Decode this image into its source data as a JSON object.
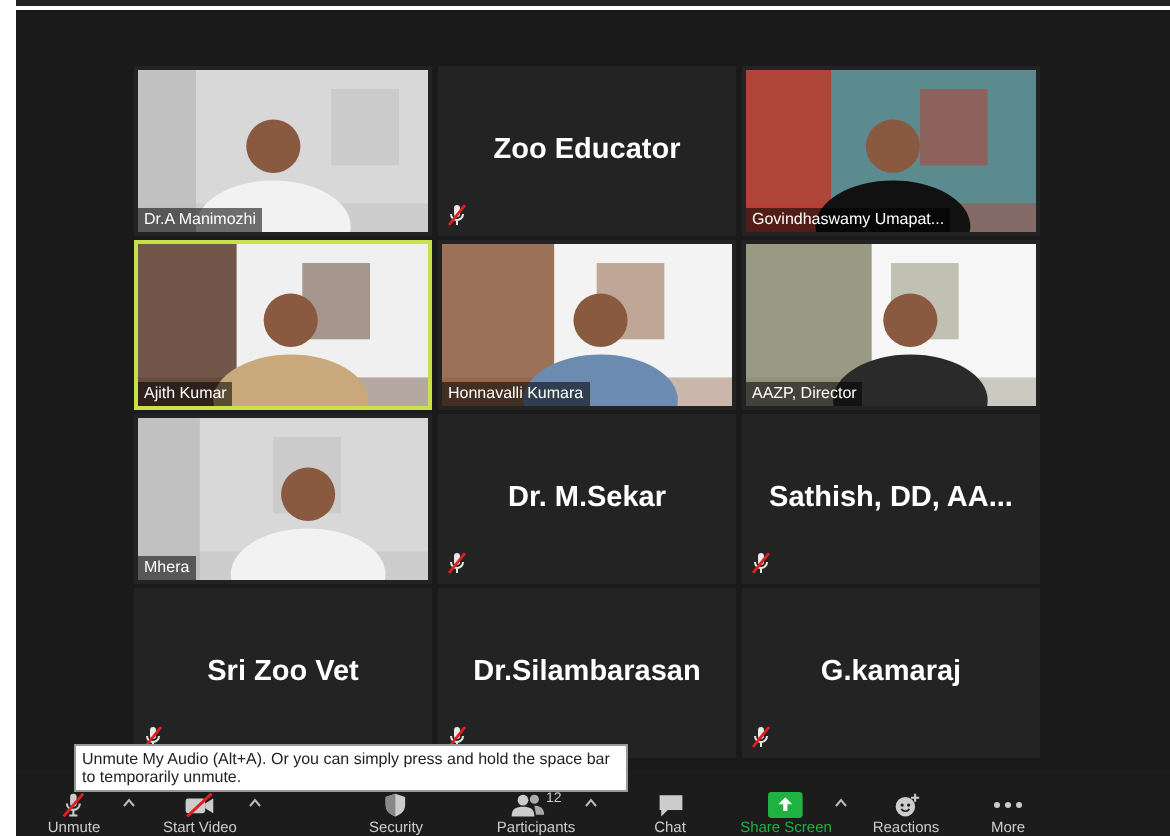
{
  "tiles": [
    {
      "kind": "video",
      "name": "Dr.A Manimozhi",
      "muted": false,
      "speaking": false
    },
    {
      "kind": "name",
      "name": "Zoo Educator",
      "muted": true,
      "speaking": false
    },
    {
      "kind": "video",
      "name": "Govindhaswamy Umapat...",
      "muted": false,
      "speaking": false
    },
    {
      "kind": "video",
      "name": "Ajith Kumar",
      "muted": false,
      "speaking": true
    },
    {
      "kind": "video",
      "name": "Honnavalli Kumara",
      "muted": false,
      "speaking": false
    },
    {
      "kind": "video",
      "name": "AAZP, Director",
      "muted": false,
      "speaking": false
    },
    {
      "kind": "video",
      "name": "Mhera",
      "muted": false,
      "speaking": false
    },
    {
      "kind": "name",
      "name": "Dr. M.Sekar",
      "muted": true,
      "speaking": false
    },
    {
      "kind": "name",
      "name": "Sathish, DD, AA...",
      "muted": true,
      "speaking": false
    },
    {
      "kind": "name",
      "name": "Sri Zoo Vet",
      "muted": true,
      "speaking": false
    },
    {
      "kind": "name",
      "name": "Dr.Silambarasan",
      "muted": true,
      "speaking": false
    },
    {
      "kind": "name",
      "name": "G.kamaraj",
      "muted": true,
      "speaking": false
    }
  ],
  "toolbar": [
    {
      "kind": "mic",
      "label": "Unmute",
      "off": true,
      "caret": true
    },
    {
      "kind": "video",
      "label": "Start Video",
      "off": true,
      "caret": true
    },
    {
      "kind": "security",
      "label": "Security",
      "caret": false
    },
    {
      "kind": "participants",
      "label": "Participants",
      "count": "12",
      "caret": true
    },
    {
      "kind": "chat",
      "label": "Chat",
      "caret": false
    },
    {
      "kind": "share",
      "label": "Share Screen",
      "caret": true
    },
    {
      "kind": "reactions",
      "label": "Reactions",
      "caret": false
    },
    {
      "kind": "more",
      "label": "More",
      "caret": false
    }
  ],
  "tooltip": "Unmute My Audio (Alt+A). Or you can simply press and hold the space bar to temporarily unmute."
}
